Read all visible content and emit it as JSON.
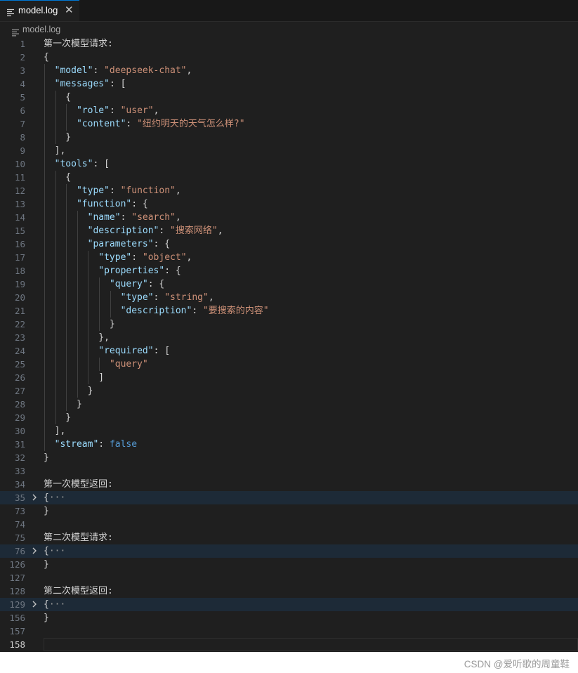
{
  "tab": {
    "title": "model.log",
    "close": "✕",
    "icon": "file-lines-icon"
  },
  "breadcrumb": {
    "file": "model.log",
    "icon": "file-lines-icon"
  },
  "watermark": "CSDN @爱听歌的周童鞋",
  "colors": {
    "key": "#9cdcfe",
    "string": "#ce9178",
    "punct": "#d4d4d4",
    "boolean": "#569cd6",
    "folded_line_bg": "#1d2a37",
    "active_tab_border": "#0078d4"
  },
  "lines": [
    {
      "n": "1",
      "tokens": [
        {
          "c": "t",
          "v": "第一次模型请求:"
        }
      ]
    },
    {
      "n": "2",
      "tokens": [
        {
          "c": "p",
          "v": "{"
        }
      ]
    },
    {
      "n": "3",
      "tokens": [
        {
          "c": "p",
          "v": "  "
        },
        {
          "c": "k",
          "v": "\"model\""
        },
        {
          "c": "p",
          "v": ": "
        },
        {
          "c": "s",
          "v": "\"deepseek-chat\""
        },
        {
          "c": "p",
          "v": ","
        }
      ]
    },
    {
      "n": "4",
      "tokens": [
        {
          "c": "p",
          "v": "  "
        },
        {
          "c": "k",
          "v": "\"messages\""
        },
        {
          "c": "p",
          "v": ": ["
        }
      ]
    },
    {
      "n": "5",
      "tokens": [
        {
          "c": "p",
          "v": "    {"
        }
      ]
    },
    {
      "n": "6",
      "tokens": [
        {
          "c": "p",
          "v": "      "
        },
        {
          "c": "k",
          "v": "\"role\""
        },
        {
          "c": "p",
          "v": ": "
        },
        {
          "c": "s",
          "v": "\"user\""
        },
        {
          "c": "p",
          "v": ","
        }
      ]
    },
    {
      "n": "7",
      "tokens": [
        {
          "c": "p",
          "v": "      "
        },
        {
          "c": "k",
          "v": "\"content\""
        },
        {
          "c": "p",
          "v": ": "
        },
        {
          "c": "s",
          "v": "\"纽约明天的天气怎么样?\""
        }
      ]
    },
    {
      "n": "8",
      "tokens": [
        {
          "c": "p",
          "v": "    }"
        }
      ]
    },
    {
      "n": "9",
      "tokens": [
        {
          "c": "p",
          "v": "  ],"
        }
      ]
    },
    {
      "n": "10",
      "tokens": [
        {
          "c": "p",
          "v": "  "
        },
        {
          "c": "k",
          "v": "\"tools\""
        },
        {
          "c": "p",
          "v": ": ["
        }
      ]
    },
    {
      "n": "11",
      "tokens": [
        {
          "c": "p",
          "v": "    {"
        }
      ]
    },
    {
      "n": "12",
      "tokens": [
        {
          "c": "p",
          "v": "      "
        },
        {
          "c": "k",
          "v": "\"type\""
        },
        {
          "c": "p",
          "v": ": "
        },
        {
          "c": "s",
          "v": "\"function\""
        },
        {
          "c": "p",
          "v": ","
        }
      ]
    },
    {
      "n": "13",
      "tokens": [
        {
          "c": "p",
          "v": "      "
        },
        {
          "c": "k",
          "v": "\"function\""
        },
        {
          "c": "p",
          "v": ": {"
        }
      ]
    },
    {
      "n": "14",
      "tokens": [
        {
          "c": "p",
          "v": "        "
        },
        {
          "c": "k",
          "v": "\"name\""
        },
        {
          "c": "p",
          "v": ": "
        },
        {
          "c": "s",
          "v": "\"search\""
        },
        {
          "c": "p",
          "v": ","
        }
      ]
    },
    {
      "n": "15",
      "tokens": [
        {
          "c": "p",
          "v": "        "
        },
        {
          "c": "k",
          "v": "\"description\""
        },
        {
          "c": "p",
          "v": ": "
        },
        {
          "c": "s",
          "v": "\"搜索网络\""
        },
        {
          "c": "p",
          "v": ","
        }
      ]
    },
    {
      "n": "16",
      "tokens": [
        {
          "c": "p",
          "v": "        "
        },
        {
          "c": "k",
          "v": "\"parameters\""
        },
        {
          "c": "p",
          "v": ": {"
        }
      ]
    },
    {
      "n": "17",
      "tokens": [
        {
          "c": "p",
          "v": "          "
        },
        {
          "c": "k",
          "v": "\"type\""
        },
        {
          "c": "p",
          "v": ": "
        },
        {
          "c": "s",
          "v": "\"object\""
        },
        {
          "c": "p",
          "v": ","
        }
      ]
    },
    {
      "n": "18",
      "tokens": [
        {
          "c": "p",
          "v": "          "
        },
        {
          "c": "k",
          "v": "\"properties\""
        },
        {
          "c": "p",
          "v": ": {"
        }
      ]
    },
    {
      "n": "19",
      "tokens": [
        {
          "c": "p",
          "v": "            "
        },
        {
          "c": "k",
          "v": "\"query\""
        },
        {
          "c": "p",
          "v": ": {"
        }
      ]
    },
    {
      "n": "20",
      "tokens": [
        {
          "c": "p",
          "v": "              "
        },
        {
          "c": "k",
          "v": "\"type\""
        },
        {
          "c": "p",
          "v": ": "
        },
        {
          "c": "s",
          "v": "\"string\""
        },
        {
          "c": "p",
          "v": ","
        }
      ]
    },
    {
      "n": "21",
      "tokens": [
        {
          "c": "p",
          "v": "              "
        },
        {
          "c": "k",
          "v": "\"description\""
        },
        {
          "c": "p",
          "v": ": "
        },
        {
          "c": "s",
          "v": "\"要搜索的内容\""
        }
      ]
    },
    {
      "n": "22",
      "tokens": [
        {
          "c": "p",
          "v": "            }"
        }
      ]
    },
    {
      "n": "23",
      "tokens": [
        {
          "c": "p",
          "v": "          },"
        }
      ]
    },
    {
      "n": "24",
      "tokens": [
        {
          "c": "p",
          "v": "          "
        },
        {
          "c": "k",
          "v": "\"required\""
        },
        {
          "c": "p",
          "v": ": ["
        }
      ]
    },
    {
      "n": "25",
      "tokens": [
        {
          "c": "p",
          "v": "            "
        },
        {
          "c": "s",
          "v": "\"query\""
        }
      ]
    },
    {
      "n": "26",
      "tokens": [
        {
          "c": "p",
          "v": "          ]"
        }
      ]
    },
    {
      "n": "27",
      "tokens": [
        {
          "c": "p",
          "v": "        }"
        }
      ]
    },
    {
      "n": "28",
      "tokens": [
        {
          "c": "p",
          "v": "      }"
        }
      ]
    },
    {
      "n": "29",
      "tokens": [
        {
          "c": "p",
          "v": "    }"
        }
      ]
    },
    {
      "n": "30",
      "tokens": [
        {
          "c": "p",
          "v": "  ],"
        }
      ]
    },
    {
      "n": "31",
      "tokens": [
        {
          "c": "p",
          "v": "  "
        },
        {
          "c": "k",
          "v": "\"stream\""
        },
        {
          "c": "p",
          "v": ": "
        },
        {
          "c": "b",
          "v": "false"
        }
      ]
    },
    {
      "n": "32",
      "tokens": [
        {
          "c": "p",
          "v": "}"
        }
      ]
    },
    {
      "n": "33",
      "tokens": []
    },
    {
      "n": "34",
      "tokens": [
        {
          "c": "t",
          "v": "第一次模型返回:"
        }
      ]
    },
    {
      "n": "35",
      "folded": true,
      "tokens": [
        {
          "c": "p",
          "v": "{"
        },
        {
          "c": "e",
          "v": "···"
        }
      ]
    },
    {
      "n": "73",
      "tokens": [
        {
          "c": "p",
          "v": "}"
        }
      ]
    },
    {
      "n": "74",
      "tokens": []
    },
    {
      "n": "75",
      "tokens": [
        {
          "c": "t",
          "v": "第二次模型请求:"
        }
      ]
    },
    {
      "n": "76",
      "folded": true,
      "tokens": [
        {
          "c": "p",
          "v": "{"
        },
        {
          "c": "e",
          "v": "···"
        }
      ]
    },
    {
      "n": "126",
      "tokens": [
        {
          "c": "p",
          "v": "}"
        }
      ]
    },
    {
      "n": "127",
      "tokens": []
    },
    {
      "n": "128",
      "tokens": [
        {
          "c": "t",
          "v": "第二次模型返回:"
        }
      ]
    },
    {
      "n": "129",
      "folded": true,
      "tokens": [
        {
          "c": "p",
          "v": "{"
        },
        {
          "c": "e",
          "v": "···"
        }
      ]
    },
    {
      "n": "156",
      "tokens": [
        {
          "c": "p",
          "v": "}"
        }
      ]
    },
    {
      "n": "157",
      "tokens": []
    },
    {
      "n": "158",
      "active": true,
      "tokens": []
    }
  ]
}
